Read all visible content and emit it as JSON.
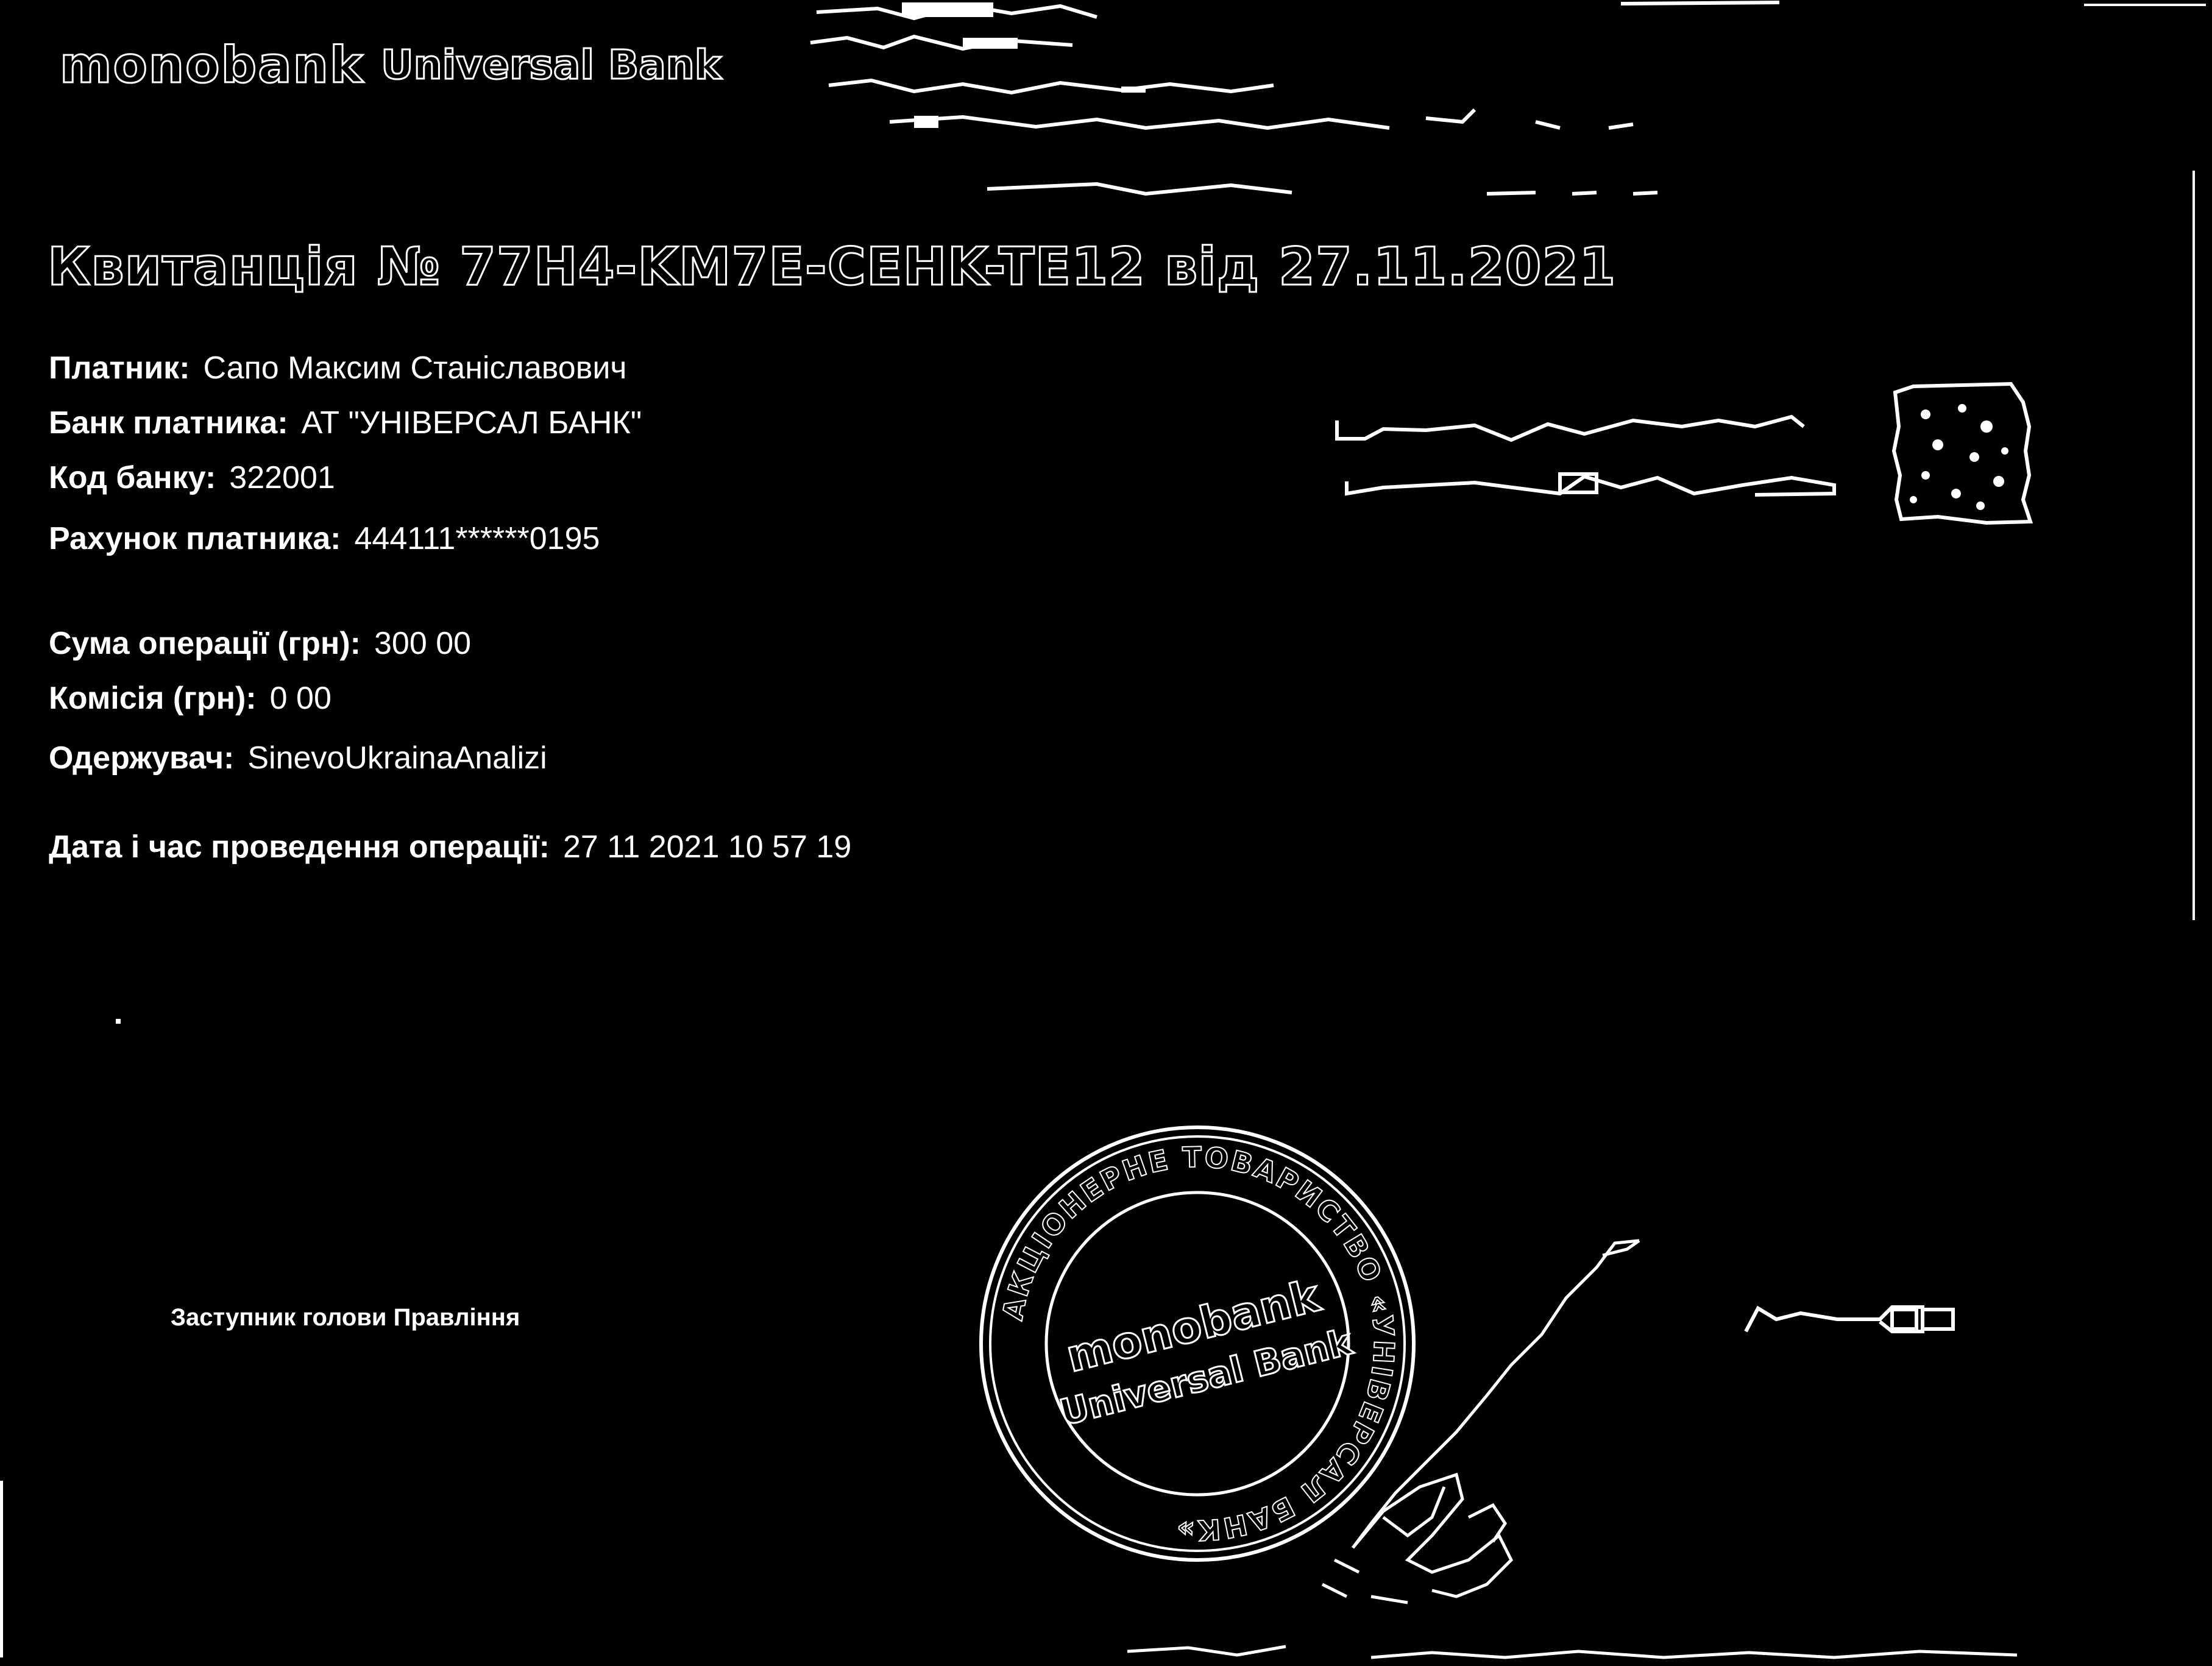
{
  "header": {
    "brand_name": "monobank",
    "bank_name": "Universal Bank"
  },
  "receipt": {
    "title": "Квитанція № 77H4-KM7E-CEHK-TE12 від 27.11.2021",
    "payer_label": "Платник:",
    "payer_value": "Сапо Максим Станіславович",
    "payer_bank_label": "Банк платника:",
    "payer_bank_value": "АТ \"УНІВЕРСАЛ БАНК\"",
    "bank_code_label": "Код банку:",
    "bank_code_value": "322001",
    "payer_account_label": "Рахунок платника:",
    "payer_account_value": "444111******0195",
    "amount_label": "Сума операції (грн):",
    "amount_value": "300 00",
    "commission_label": "Комісія (грн):",
    "commission_value": "0 00",
    "recipient_label": "Одержувач:",
    "recipient_value": "SinevoUkrainaAnalizi",
    "datetime_label": "Дата і час проведення операції:",
    "datetime_value": "27 11 2021 10 57 19"
  },
  "footer": {
    "signatory": "Заступник голови Правління"
  },
  "stamp": {
    "ring_text": "АКЦІОНЕРНЕ ТОВАРИСТВО «УНІВЕРСАЛ БАНК»",
    "center_top": "monobank",
    "center_bottom": "Universal Bank"
  },
  "colors": {
    "background": "#000000",
    "foreground": "#ffffff"
  }
}
